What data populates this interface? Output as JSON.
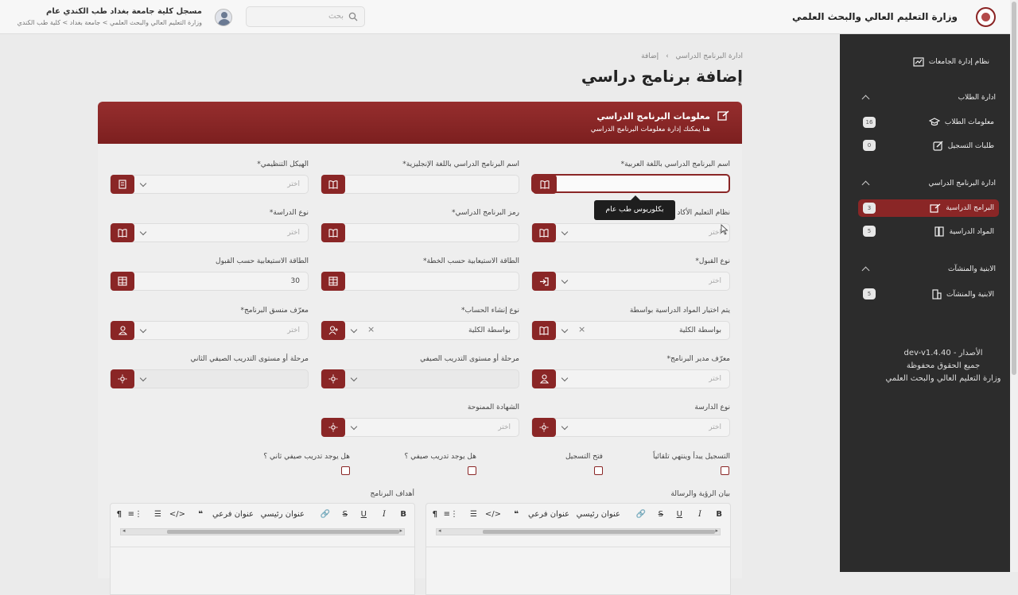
{
  "header": {
    "ministry": "وزارة التعليم العالي والبحث العلمي",
    "search_placeholder": "بحث",
    "user_name": "مسجل كلية جامعة بغداد طب الكندي عام",
    "user_path": "وزارة التعليم العالي والبحث العلمي > جامعة بغداد > كلية طب الكندي"
  },
  "sidebar": {
    "system": "نظام إدارة الجامعات",
    "sections": [
      {
        "title": "ادارة الطلاب",
        "items": [
          {
            "label": "معلومات الطلاب",
            "count": "16"
          },
          {
            "label": "طلبات التسجيل",
            "count": "0"
          }
        ]
      },
      {
        "title": "ادارة البرنامج الدراسي",
        "items": [
          {
            "label": "البرامج الدراسية",
            "count": "3"
          },
          {
            "label": "المواد الدراسية",
            "count": "5"
          }
        ]
      },
      {
        "title": "الابنية والمنشآت",
        "items": [
          {
            "label": "الابنية والمنشآت",
            "count": "5"
          }
        ]
      }
    ],
    "version": "الأصدار - dev-v1.4.40",
    "rights": "جميع الحقوق محفوظة",
    "owner": "وزارة التعليم العالي والبحث العلمي"
  },
  "page": {
    "crumb_parent": "ادارة البرنامج الدراسي",
    "crumb_current": "إضافة",
    "title": "إضافة برنامج دراسي"
  },
  "card": {
    "title": "معلومات البرنامج الدراسي",
    "subtitle": "هنا يمكنك إدارة معلومات البرنامج الدراسي"
  },
  "form": {
    "select_placeholder": "اختر",
    "fields": [
      {
        "label": "اسم البرنامج الدراسي باللغة العربية*",
        "value": "",
        "placeholder": ""
      },
      {
        "label": "اسم البرنامج الدراسي باللغة الإنجليزية*",
        "value": "",
        "placeholder": ""
      },
      {
        "label": "الهيكل التنظيمي*",
        "value": "",
        "placeholder": "اختر"
      },
      {
        "label": "نظام التعليم الأكاد",
        "value": "",
        "placeholder": "اختر"
      },
      {
        "label": "رمز البرنامج الدراسي*",
        "value": "",
        "placeholder": ""
      },
      {
        "label": "نوع الدراسة*",
        "value": "",
        "placeholder": "اختر"
      },
      {
        "label": "نوع القبول*",
        "value": "",
        "placeholder": "اختر"
      },
      {
        "label": "الطاقة الاستيعابية حسب الخطة*",
        "value": "",
        "placeholder": ""
      },
      {
        "label": "الطاقة الاستيعابية حسب القبول",
        "value": "30",
        "placeholder": ""
      },
      {
        "label": "يتم اختيار المواد الدراسية بواسطة",
        "value": "بواسطة الكلية",
        "placeholder": ""
      },
      {
        "label": "نوع إنشاء الحساب*",
        "value": "بواسطة الكلية",
        "placeholder": ""
      },
      {
        "label": "معرّف منسق البرنامج*",
        "value": "",
        "placeholder": "اختر"
      },
      {
        "label": "معرّف مدير البرنامج*",
        "value": "",
        "placeholder": "اختر"
      },
      {
        "label": "مرحلة أو مستوى التدريب الصيفي",
        "value": "",
        "placeholder": ""
      },
      {
        "label": "مرحلة أو مستوى التدريب الصيفي الثاني",
        "value": "",
        "placeholder": ""
      },
      {
        "label": "نوع الدارسة",
        "value": "",
        "placeholder": "اختر"
      },
      {
        "label": "الشهادة الممنوحة",
        "value": "",
        "placeholder": "اختر"
      }
    ],
    "tooltip": "بكلوريوس طب عام",
    "checkboxes": [
      "التسجيل يبدأ وينتهي تلقائياً",
      "فتح التسجيل",
      "هل يوجد تدريب صيفي ؟",
      "هل يوجد تدريب صيفي ثاني ؟"
    ],
    "editors": [
      "بيان الرؤية والرسالة",
      "أهداف البرنامج"
    ],
    "toolbar": {
      "heading": "عنوان رئيسي",
      "subheading": "عنوان فرعي"
    }
  }
}
